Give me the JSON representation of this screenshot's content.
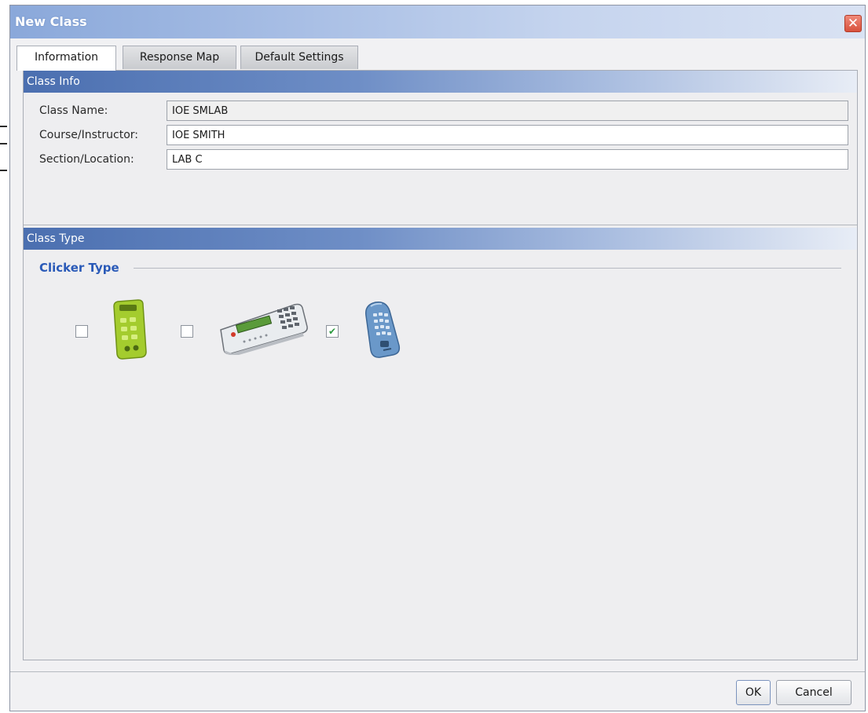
{
  "window": {
    "title": "New Class",
    "close_glyph": "✕"
  },
  "tabs": [
    {
      "label": "Information",
      "active": true
    },
    {
      "label": "Response Map",
      "active": false
    },
    {
      "label": "Default Settings",
      "active": false
    }
  ],
  "class_info": {
    "header": "Class Info",
    "fields": [
      {
        "label": "Class Name:",
        "value": "IOE SMLAB",
        "readonly": true
      },
      {
        "label": "Course/Instructor:",
        "value": "IOE SMITH",
        "readonly": false
      },
      {
        "label": "Section/Location:",
        "value": "LAB C",
        "readonly": false
      }
    ]
  },
  "class_type": {
    "header": "Class Type",
    "clicker_type_label": "Clicker Type",
    "options": [
      {
        "icon": "green-clicker-icon",
        "checked": false
      },
      {
        "icon": "keypad-device-icon",
        "checked": false
      },
      {
        "icon": "blue-clicker-icon",
        "checked": true
      }
    ]
  },
  "buttons": {
    "ok": "OK",
    "cancel": "Cancel"
  },
  "colors": {
    "section_header": "#4b6fb0",
    "legend_text": "#2a5ab8",
    "checkmark": "#2d9a3f"
  }
}
